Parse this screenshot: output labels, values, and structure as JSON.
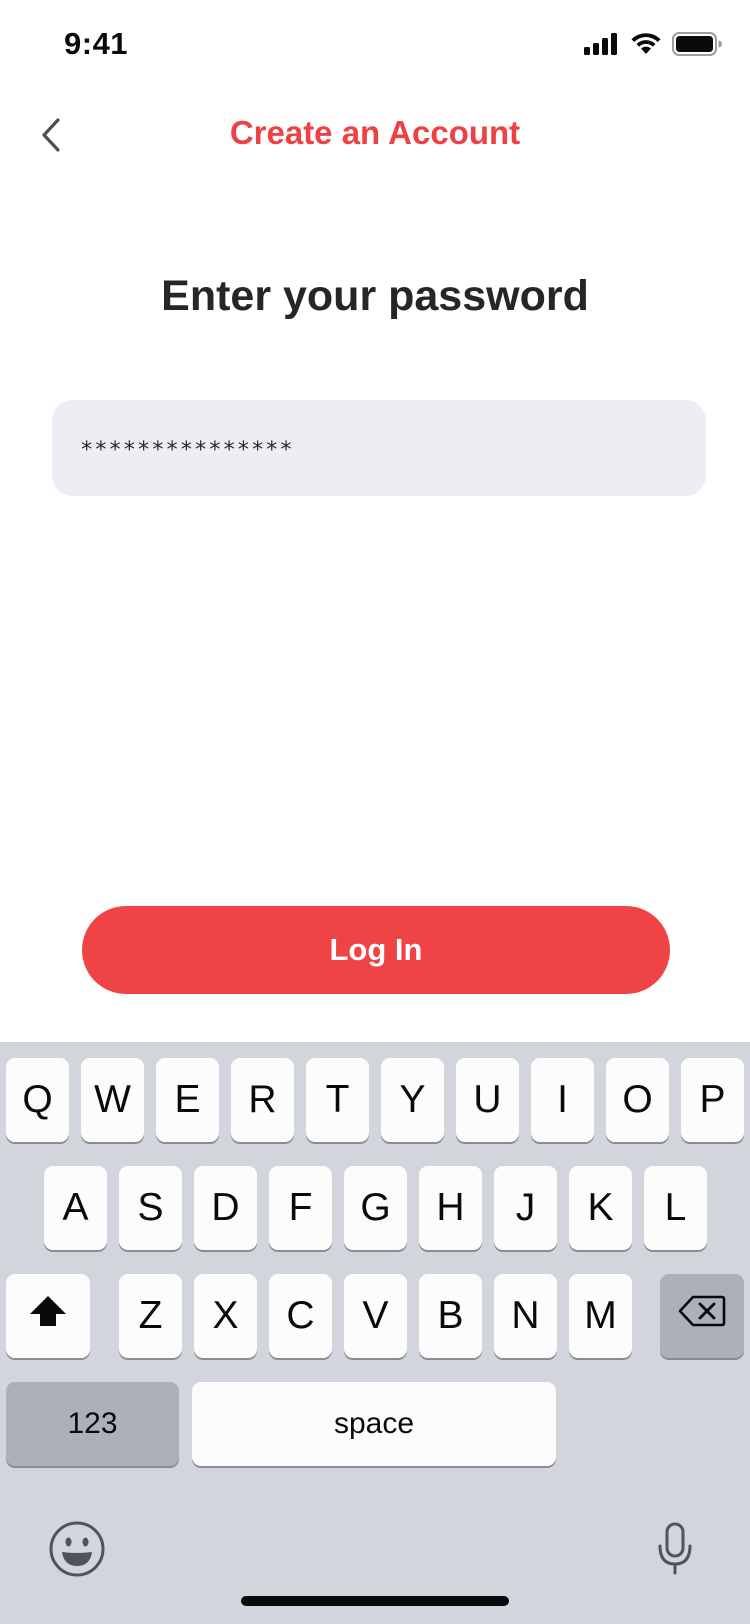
{
  "status_bar": {
    "time": "9:41",
    "icons": [
      "cellular-signal-icon",
      "wifi-icon",
      "battery-icon"
    ]
  },
  "nav": {
    "back_icon": "chevron-left-icon",
    "title": "Create an Account"
  },
  "heading": "Enter your password",
  "password_field": {
    "value": "***************"
  },
  "login_button": {
    "label": "Log In"
  },
  "keyboard": {
    "row1": [
      "Q",
      "W",
      "E",
      "R",
      "T",
      "Y",
      "U",
      "I",
      "O",
      "P"
    ],
    "row2": [
      "A",
      "S",
      "D",
      "F",
      "G",
      "H",
      "J",
      "K",
      "L"
    ],
    "row3": [
      "Z",
      "X",
      "C",
      "V",
      "B",
      "N",
      "M"
    ],
    "shift_icon": "shift-arrow-icon",
    "backspace_icon": "backspace-icon",
    "numbers_key": "123",
    "space_key": "space",
    "emoji_icon": "emoji-icon",
    "mic_icon": "microphone-icon"
  },
  "colors": {
    "accent": "#EE4144",
    "field_bg": "#ECEEF3",
    "keyboard_bg": "#D2D5DC"
  }
}
